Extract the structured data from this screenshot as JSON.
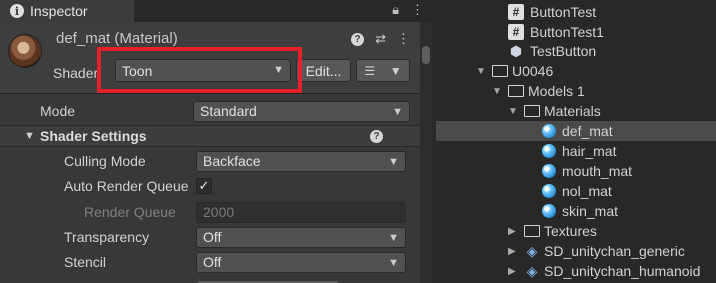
{
  "inspector": {
    "tab_label": "Inspector",
    "tab_icons": [
      "lock-icon",
      "menu-dots-icon"
    ],
    "material_title": "def_mat (Material)",
    "header_icons": [
      "help-icon",
      "preset-icon",
      "more-icon"
    ],
    "shader_label": "Shader",
    "shader_value": "Toon",
    "edit_label": "Edit...",
    "mode_label": "Mode",
    "mode_value": "Standard",
    "section_title": "Shader Settings",
    "culling_label": "Culling Mode",
    "culling_value": "Backface",
    "auto_rq_label": "Auto Render Queue",
    "auto_rq_checked": true,
    "render_queue_label": "Render Queue",
    "render_queue_value": "2000",
    "transparency_label": "Transparency",
    "transparency_value": "Off",
    "stencil_label": "Stencil",
    "stencil_value": "Off",
    "highlight_color": "#e8202a"
  },
  "hierarchy": {
    "items": [
      {
        "label": "ButtonTest",
        "icon": "script-icon",
        "selected": false
      },
      {
        "label": "ButtonTest1",
        "icon": "script-icon",
        "selected": false
      },
      {
        "label": "TestButton",
        "icon": "prefab-icon",
        "selected": false
      },
      {
        "label": "U0046",
        "icon": "folder-open-icon",
        "selected": false
      },
      {
        "label": "Models 1",
        "icon": "folder-open-icon",
        "selected": false
      },
      {
        "label": "Materials",
        "icon": "folder-open-icon",
        "selected": false
      },
      {
        "label": "def_mat",
        "icon": "material-icon",
        "selected": true
      },
      {
        "label": "hair_mat",
        "icon": "material-icon",
        "selected": false
      },
      {
        "label": "mouth_mat",
        "icon": "material-icon",
        "selected": false
      },
      {
        "label": "nol_mat",
        "icon": "material-icon",
        "selected": false
      },
      {
        "label": "skin_mat",
        "icon": "material-icon",
        "selected": false
      },
      {
        "label": "Textures",
        "icon": "folder-icon",
        "selected": false
      },
      {
        "label": "SD_unitychan_generic",
        "icon": "model-icon",
        "selected": false
      },
      {
        "label": "SD_unitychan_humanoid",
        "icon": "model-icon",
        "selected": false
      }
    ]
  }
}
